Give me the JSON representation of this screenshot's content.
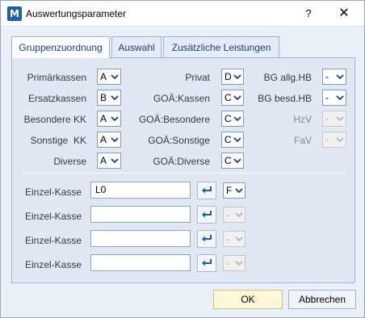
{
  "window": {
    "title": "Auswertungsparameter",
    "icon_letter": "M",
    "help_label": "?",
    "close_label": "✕"
  },
  "tabs": [
    {
      "label": "Gruppenzuordnung",
      "active": true
    },
    {
      "label": "Auswahl",
      "active": false
    },
    {
      "label": "Zusätzliche Leistungen",
      "active": false
    }
  ],
  "groups": {
    "col1": [
      {
        "label": "Primärkassen",
        "value": "A"
      },
      {
        "label": "Ersatzkassen",
        "value": "B"
      },
      {
        "label": "Besondere KK",
        "value": "A"
      },
      {
        "label": "Sonstige  KK",
        "value": "A"
      },
      {
        "label": "Diverse",
        "value": "A"
      }
    ],
    "col2": [
      {
        "label": "Privat",
        "value": "D"
      },
      {
        "label": "GOÄ:Kassen",
        "value": "C"
      },
      {
        "label": "GOÄ:Besondere",
        "value": "C"
      },
      {
        "label": "GOÄ:Sonstige",
        "value": "C"
      },
      {
        "label": "GOÄ:Diverse",
        "value": "C"
      }
    ],
    "col3": [
      {
        "label": "BG allg.HB",
        "value": "-",
        "enabled": true
      },
      {
        "label": "BG besd.HB",
        "value": "-",
        "enabled": true
      },
      {
        "label": "HzV",
        "value": "-",
        "enabled": false
      },
      {
        "label": "FaV",
        "value": "-",
        "enabled": false
      }
    ]
  },
  "einzel_kassen": [
    {
      "label": "Einzel-Kasse",
      "value": "L0",
      "group": "F",
      "group_enabled": true
    },
    {
      "label": "Einzel-Kasse",
      "value": "",
      "group": "-",
      "group_enabled": false
    },
    {
      "label": "Einzel-Kasse",
      "value": "",
      "group": "-",
      "group_enabled": false
    },
    {
      "label": "Einzel-Kasse",
      "value": "",
      "group": "-",
      "group_enabled": false
    }
  ],
  "buttons": {
    "ok": "OK",
    "cancel": "Abbrechen"
  }
}
